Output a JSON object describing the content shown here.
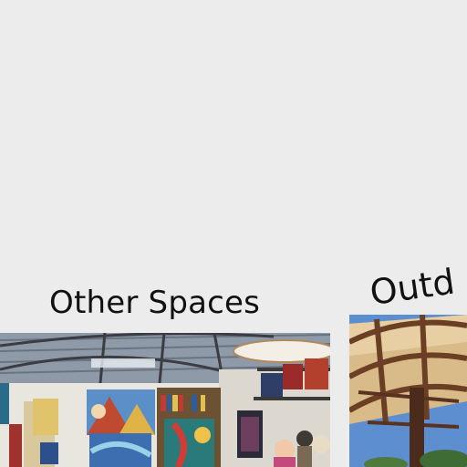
{
  "cards": [
    {
      "title": "Other Spaces",
      "image": "art-studio-photo"
    },
    {
      "title": "Outd",
      "image": "outdoor-pergola-photo"
    }
  ],
  "colors": {
    "background": "#ececec",
    "title_text": "#111111"
  }
}
